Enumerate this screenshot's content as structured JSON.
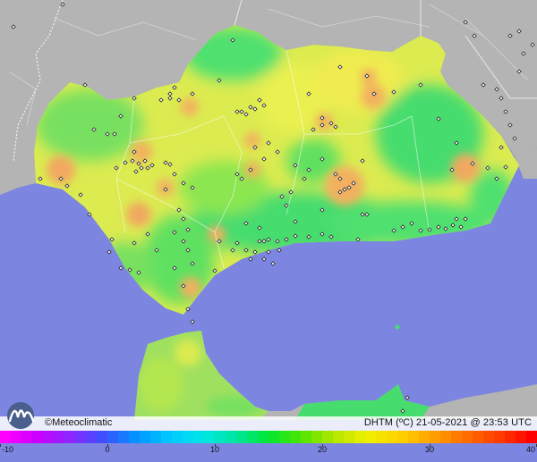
{
  "legend": {
    "brand_symbol": "©",
    "brand_name": "Meteoclimatic",
    "product_label": "DHTM (ºC)",
    "date": "21-05-2021",
    "at": "@",
    "time": "23:53 UTC"
  },
  "colorbar": {
    "ticks": [
      "-10",
      "0",
      "10",
      "20",
      "30",
      "40"
    ],
    "min": -10,
    "max": 40,
    "tick_values": [
      -10,
      0,
      10,
      20,
      30,
      40
    ],
    "colors": [
      "#ff00ff",
      "#c800ff",
      "#8c28ff",
      "#3c50ff",
      "#0096ff",
      "#00c8ff",
      "#00e6e6",
      "#00e6a0",
      "#00e632",
      "#50e600",
      "#b4e600",
      "#f0f000",
      "#ffd200",
      "#ffa000",
      "#ff6e00",
      "#ff3c00",
      "#ff0000"
    ]
  },
  "colors": {
    "sea": "#7c86e0",
    "land_outside": "#b4b4b4",
    "warm_hotspot": "#f2a860",
    "cool_zone": "#46dc6e",
    "base_land": "#dceb50"
  }
}
